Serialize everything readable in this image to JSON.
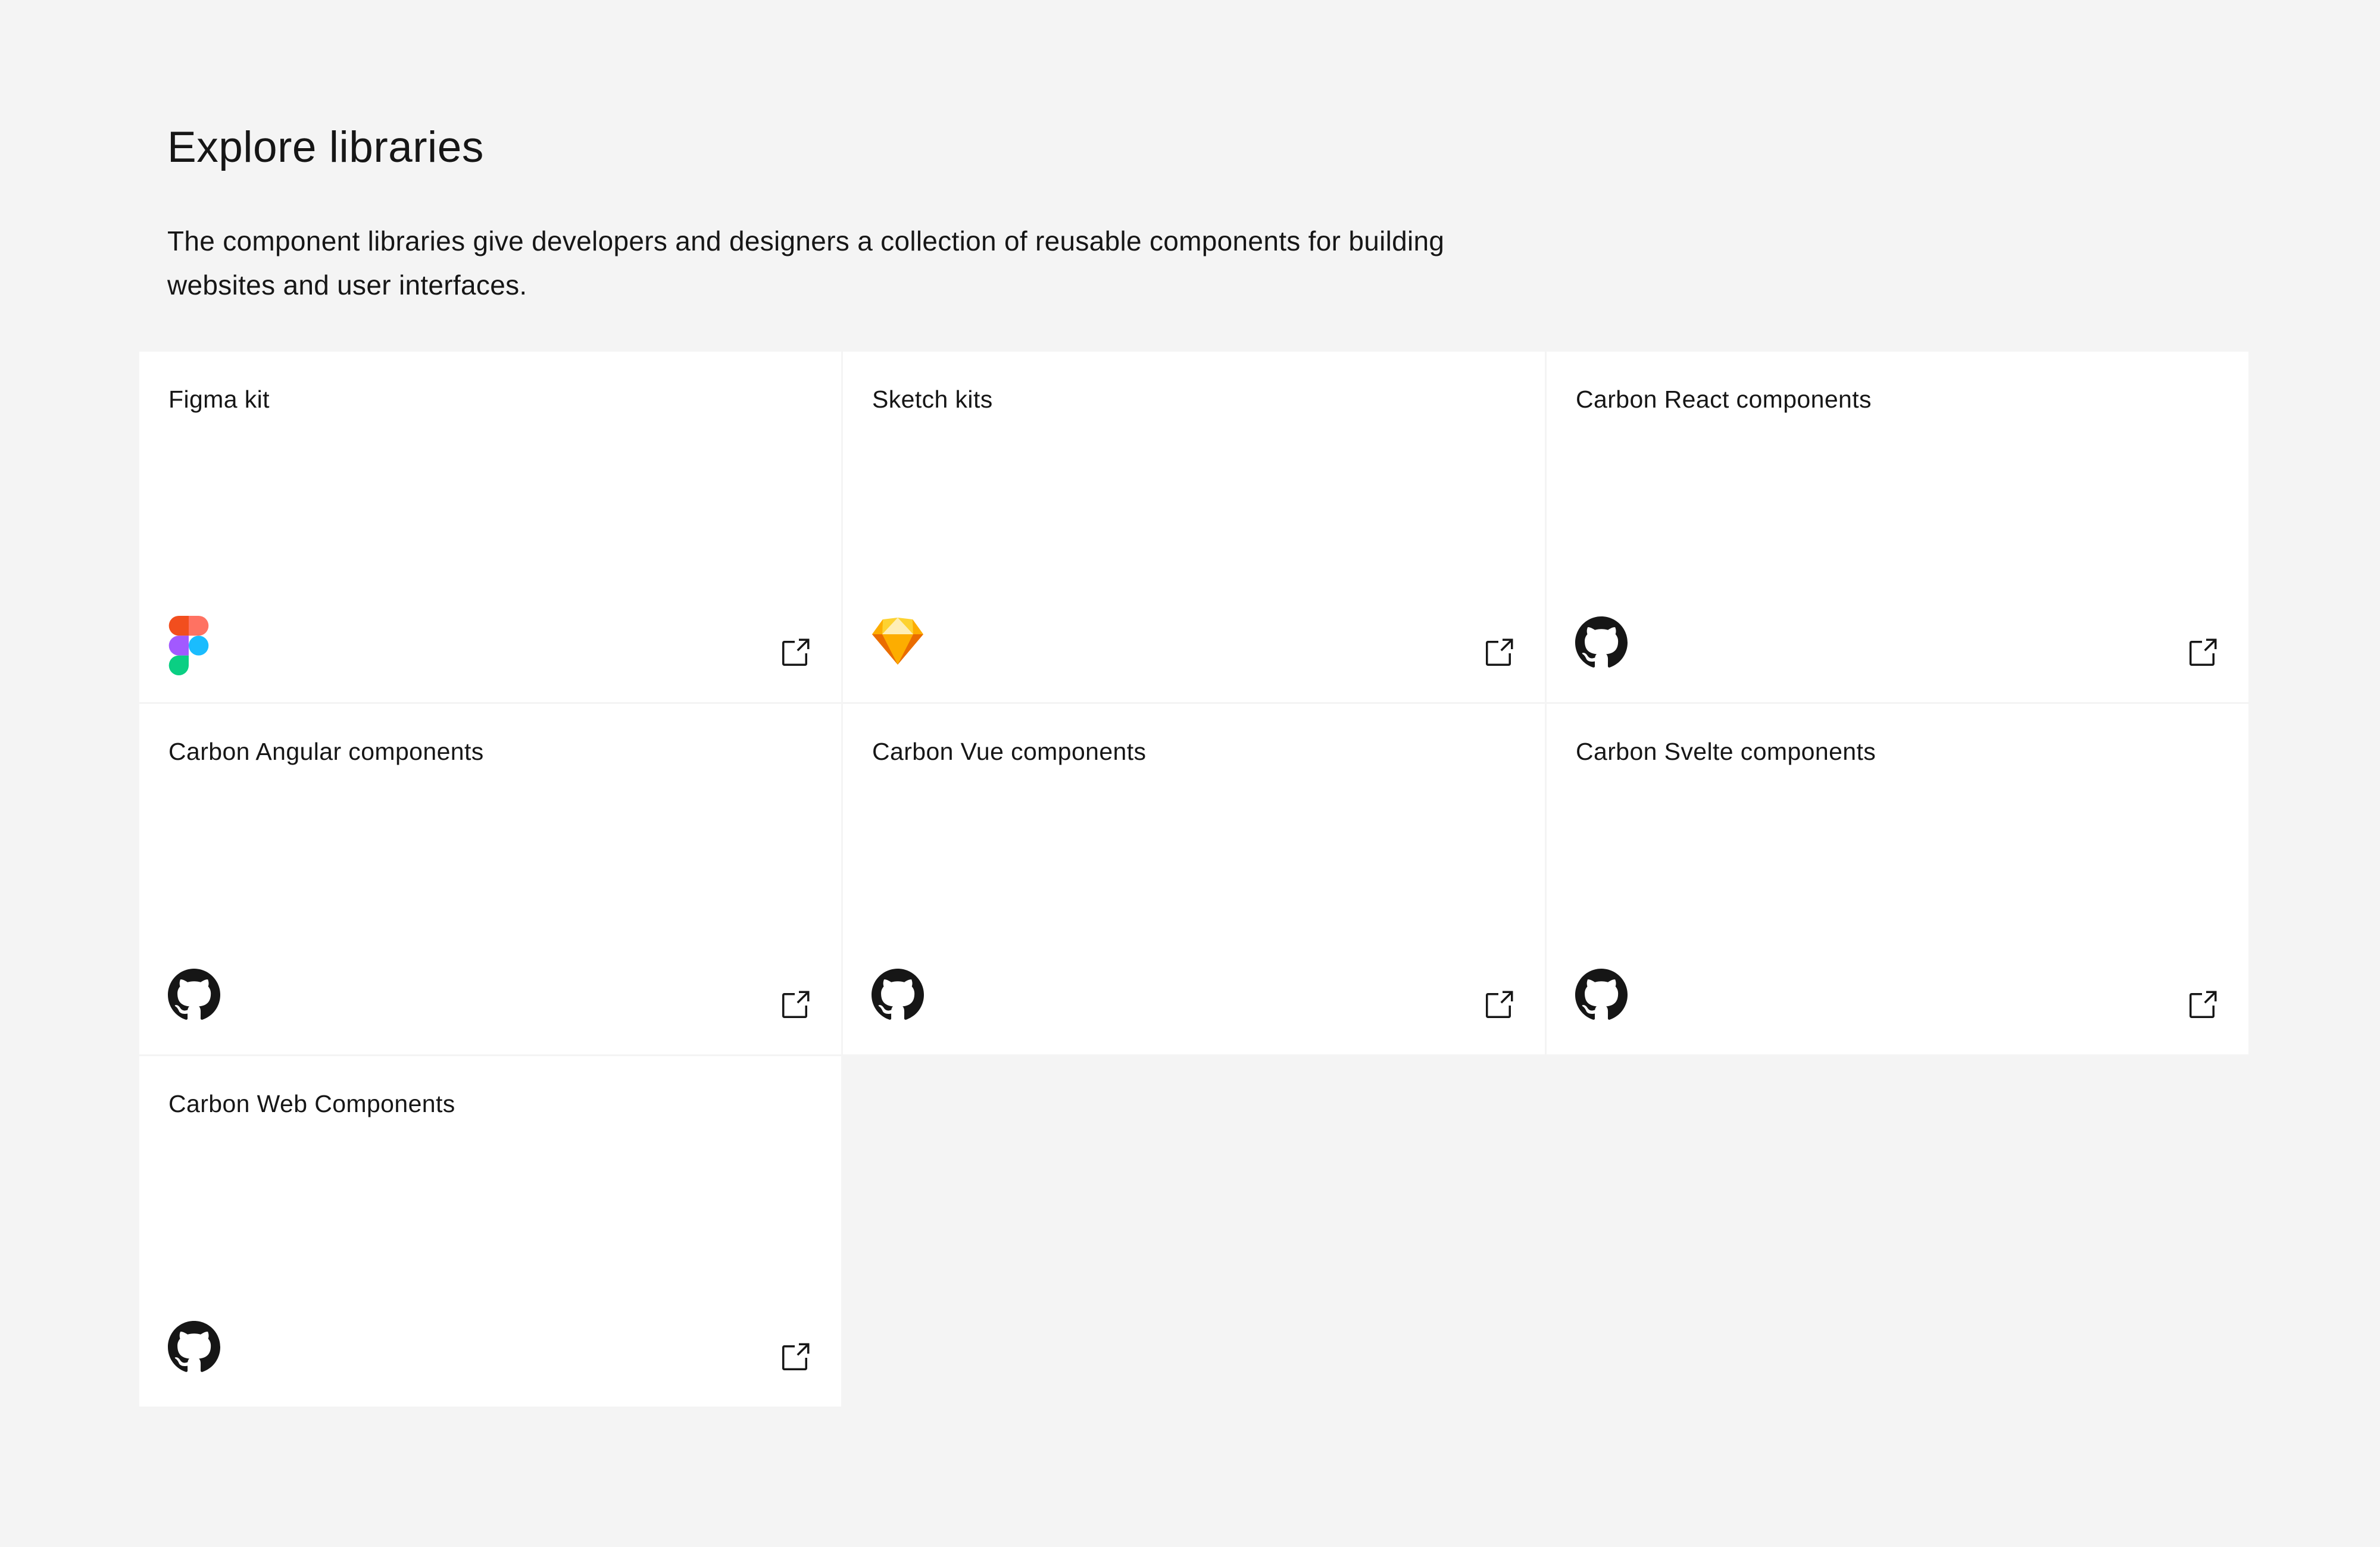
{
  "section": {
    "heading": "Explore libraries",
    "description": "The component libraries give developers and designers a collection of reusable components for building websites and user interfaces."
  },
  "tiles": [
    {
      "title": "Figma kit",
      "icon": "figma-logo-icon",
      "action_icon": "launch-icon"
    },
    {
      "title": "Sketch kits",
      "icon": "sketch-logo-icon",
      "action_icon": "launch-icon"
    },
    {
      "title": "Carbon React components",
      "icon": "github-logo-icon",
      "action_icon": "launch-icon"
    },
    {
      "title": "Carbon Angular components",
      "icon": "github-logo-icon",
      "action_icon": "launch-icon"
    },
    {
      "title": "Carbon Vue components",
      "icon": "github-logo-icon",
      "action_icon": "launch-icon"
    },
    {
      "title": "Carbon Svelte components",
      "icon": "github-logo-icon",
      "action_icon": "launch-icon"
    },
    {
      "title": "Carbon Web Components",
      "icon": "github-logo-icon",
      "action_icon": "launch-icon"
    }
  ],
  "colors": {
    "page_background": "#f4f4f4",
    "tile_background": "#ffffff",
    "text_primary": "#161616",
    "divider": "#e0e0e0"
  }
}
